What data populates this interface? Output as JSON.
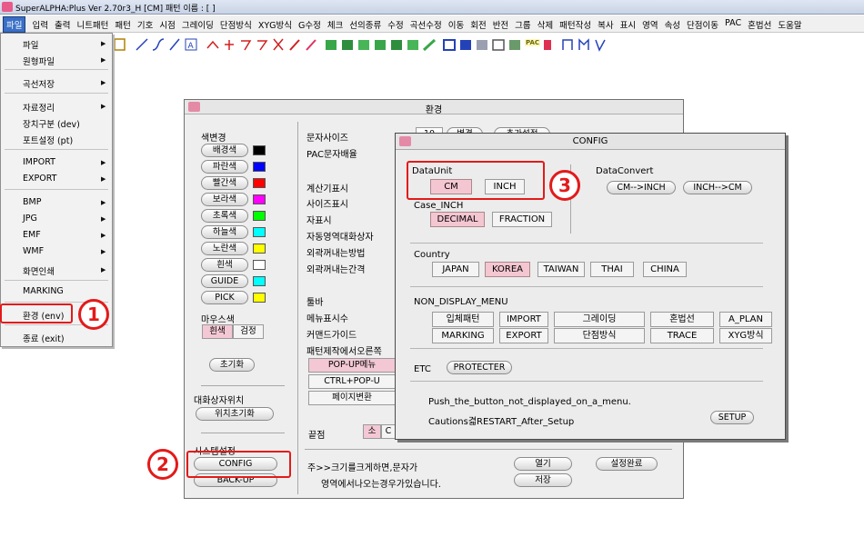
{
  "app": {
    "title": "SuperALPHA:Plus Ver 2.70r3_H [CM]   패턴 이름 : [ ]"
  },
  "menubar": [
    "파일",
    "입력",
    "출력",
    "니트패턴",
    "패턴",
    "기호",
    "시점",
    "그레이딩",
    "단점방식",
    "XYG방식",
    "G수정",
    "체크",
    "선의종류",
    "수정",
    "곡선수정",
    "이동",
    "회전",
    "반전",
    "그룹",
    "삭제",
    "패턴작성",
    "복사",
    "표시",
    "영역",
    "속성",
    "단점이동",
    "PAC",
    "혼법선",
    "도움말"
  ],
  "file_menu": {
    "items": [
      {
        "label": "파일",
        "submenu": true
      },
      {
        "label": "원형파일",
        "submenu": true
      },
      {
        "label": "곡선저장",
        "submenu": true
      },
      {
        "label": "자료정리",
        "submenu": true
      },
      {
        "label": "장치구분 (dev)",
        "submenu": false
      },
      {
        "label": "포트설정 (pt)",
        "submenu": false
      },
      {
        "label": "IMPORT",
        "submenu": true
      },
      {
        "label": "EXPORT",
        "submenu": true
      },
      {
        "label": "BMP",
        "submenu": true
      },
      {
        "label": "JPG",
        "submenu": true
      },
      {
        "label": "EMF",
        "submenu": true
      },
      {
        "label": "WMF",
        "submenu": true
      },
      {
        "label": "화면인쇄",
        "submenu": true
      },
      {
        "label": "MARKING",
        "submenu": false
      },
      {
        "label": "환경 (env)",
        "submenu": false
      },
      {
        "label": "종료 (exit)",
        "submenu": false
      }
    ],
    "arrow": "▶"
  },
  "env_window": {
    "title": "환경",
    "color_change_label": "색변경",
    "colors": [
      {
        "label": "배경색",
        "swatch": "#000000"
      },
      {
        "label": "파란색",
        "swatch": "#0000ff"
      },
      {
        "label": "빨간색",
        "swatch": "#ff0000"
      },
      {
        "label": "보라색",
        "swatch": "#ff00ff"
      },
      {
        "label": "초록색",
        "swatch": "#00ff00"
      },
      {
        "label": "하늘색",
        "swatch": "#00ffff"
      },
      {
        "label": "노란색",
        "swatch": "#ffff00"
      },
      {
        "label": "흰색",
        "swatch": "#ffffff"
      },
      {
        "label": "GUIDE",
        "swatch": "#00ffff"
      },
      {
        "label": "PICK",
        "swatch": "#ffff00"
      }
    ],
    "mouse_color_label": "마우스색",
    "mouse_white": "흰색",
    "mouse_black": "검정",
    "reset": "초기화",
    "dialog_pos_label": "대화상자위치",
    "pos_reset": "위치초기화",
    "system_label": "시스템설정",
    "config_btn": "CONFIG",
    "backup_btn": "BACK-UP",
    "right_labels": [
      "문자사이즈",
      "PAC문자배율",
      "계산기표시",
      "사이즈표시",
      "자표시",
      "자동영역대화상자",
      "외곽꺼내는방법",
      "외곽꺼내는간격",
      "툴바",
      "메뉴표시수",
      "커맨드가이드",
      "패턴제작에서오른쪽"
    ],
    "font_size_value": "10",
    "change_btn": "변경",
    "font_setting_btn": "추가설정",
    "popup_menu": "POP-UP메뉴",
    "ctrl_popup": "CTRL+POP-U",
    "page_change": "페이지변환",
    "endpoint_label": "끝점",
    "endpoint_small": "소",
    "endpoint_c": "C",
    "note_line1": "주>>크기를크게하면,문자가",
    "note_line2": "영역에서나오는경우가있습니다.",
    "open_btn": "열기",
    "save_btn": "저장",
    "done_btn": "설정완료"
  },
  "config_dialog": {
    "title": "CONFIG",
    "data_unit_label": "DataUnit",
    "cm": "CM",
    "inch": "INCH",
    "case_inch_label": "Case_INCH",
    "decimal": "DECIMAL",
    "fraction": "FRACTION",
    "data_convert_label": "DataConvert",
    "cm_to_inch": "CM-->INCH",
    "inch_to_cm": "INCH-->CM",
    "country_label": "Country",
    "countries": [
      "JAPAN",
      "KOREA",
      "TAIWAN",
      "THAI",
      "CHINA"
    ],
    "selected_country": "KOREA",
    "non_display_label": "NON_DISPLAY_MENU",
    "non_display_row1": [
      "입체패턴",
      "IMPORT",
      "그레이딩",
      "혼법선",
      "A_PLAN"
    ],
    "non_display_row2": [
      "MARKING",
      "EXPORT",
      "단점방식",
      "TRACE",
      "XYG방식"
    ],
    "etc_label": "ETC",
    "protecter": "PROTECTER",
    "push_text": "Push_the_button_not_displayed_on_a_menu.",
    "cautions_text": "Cautions겳RESTART_After_Setup",
    "setup_btn": "SETUP"
  },
  "annotations": {
    "step1": "1",
    "step2": "2",
    "step3": "3",
    "color": "#e31a1a"
  }
}
